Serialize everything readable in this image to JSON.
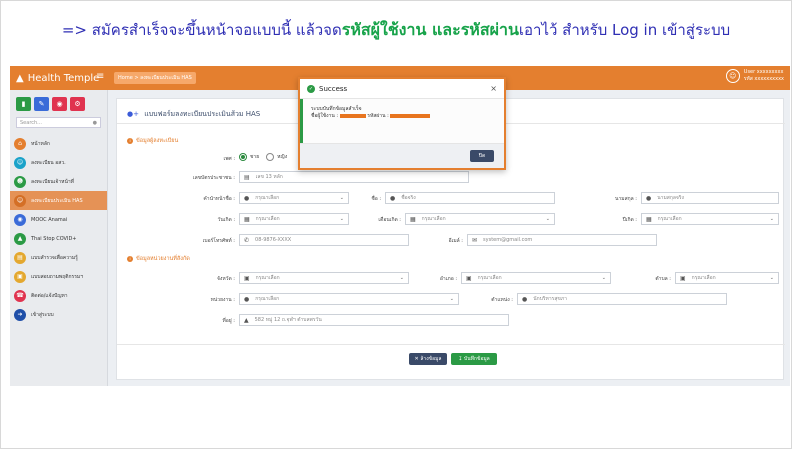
{
  "caption": {
    "part1": "=> สมัครสำเร็จจะขึ้นหน้าจอแบบนี้ แล้วจด",
    "hl1": "รหัสผู้ใช้งาน และรหัสผ่าน",
    "part2": "เอาไว้ สำหรับ Log in เข้าสู่ระบบ"
  },
  "topbar": {
    "brand": "Health Temple",
    "breadcrumb": "Home > ลงทะเบียนประเมิน HAS",
    "user_line1": "User xxxxxxxxx",
    "user_line2": "รหัส xxxxxxxxxx"
  },
  "sidebar": {
    "search_placeholder": "Search...",
    "items": [
      {
        "label": "หน้าหลัก",
        "icon": "home-icon",
        "color": "#e47f2f"
      },
      {
        "label": "ลงทะเบียน อสว.",
        "icon": "users-icon",
        "color": "#1aa2c9"
      },
      {
        "label": "ลงทะเบียนเจ้าหน้าที่",
        "icon": "user-icon",
        "color": "#2b9a45"
      },
      {
        "label": "ลงทะเบียนประเมิน HAS",
        "icon": "user-check-icon",
        "color": "#ffffff"
      },
      {
        "label": "MOOC Anamai",
        "icon": "mooc-icon",
        "color": "#3a6bd8"
      },
      {
        "label": "Thai Stop COVID+",
        "icon": "shield-icon",
        "color": "#2b9a45"
      },
      {
        "label": "แบบสำรวจเพื่อความรู้",
        "icon": "book-icon",
        "color": "#e4a82f"
      },
      {
        "label": "แบบสอบถามพฤติกรรมฯ",
        "icon": "doc-icon",
        "color": "#e4a82f"
      },
      {
        "label": "ติดต่อ/แจ้งปัญหา",
        "icon": "phone-icon",
        "color": "#e0334f"
      },
      {
        "label": "เข้าสู่ระบบ",
        "icon": "login-icon",
        "color": "#1f4fa8"
      }
    ]
  },
  "form": {
    "title": "แบบฟอร์มลงทะเบียนประเมินส้วม HAS",
    "section1": "ข้อมูลผู้ลงทะเบียน",
    "section2": "ข้อมูลหน่วยงานที่สังกัด",
    "labels": {
      "gender": "เพศ :",
      "id_card": "เลขบัตรประชาชน :",
      "prefix": "คำนำหน้าชื่อ :",
      "first_name": "ชื่อ :",
      "last_name": "นามสกุล :",
      "day": "วันเกิด :",
      "month": "เดือนเกิด :",
      "year": "ปีเกิด :",
      "phone": "เบอร์โทรศัพท์ :",
      "email": "อีเมล์ :",
      "province": "จังหวัด :",
      "district": "อำเภอ :",
      "subdistrict": "ตำบล :",
      "agency": "หน่วยงาน :",
      "position": "ตำแหน่ง :",
      "address": "ที่อยู่ :"
    },
    "gender_male": "ชาย",
    "gender_female": "หญิง",
    "placeholders": {
      "id_card": "เลข 13 หลัก",
      "select": "กรุณาเลือก",
      "first_name": "ชื่อจริง",
      "last_name": "นามสกุลจริง",
      "phone": "08-9876-XXXX",
      "email": "system@gmail.com",
      "position": "นักบริหารสุขภา",
      "address": "582 หมู่ 12 ถ.จุฬฯ ตำบลพรวัน"
    },
    "clear_button": "ล้างข้อมูล",
    "save_button": "บันทึกข้อมูล"
  },
  "modal": {
    "title": "Success",
    "message_line1": "ระบบบันทึกข้อมูลสำเร็จ",
    "user_label": "ชื่อผู้ใช้งาน :",
    "password_label": "รหัสผ่าน :",
    "close_button": "ปิด"
  }
}
